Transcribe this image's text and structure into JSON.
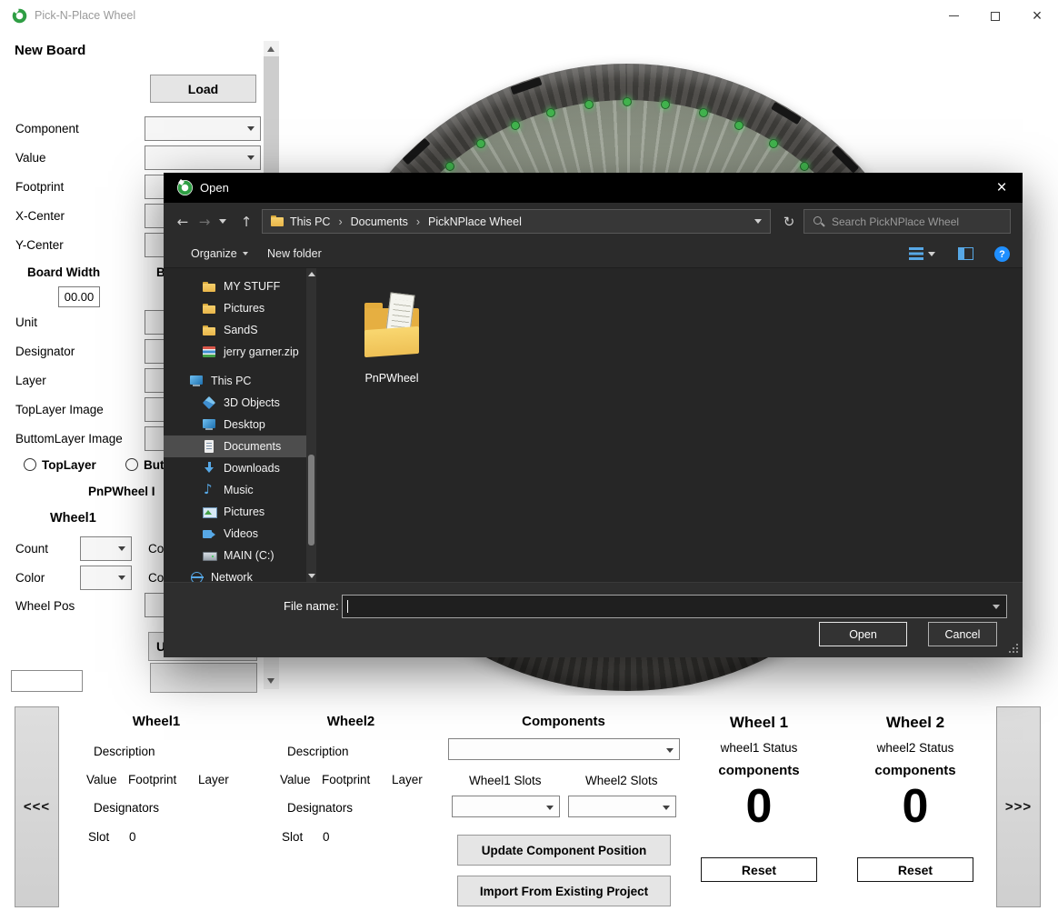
{
  "colors": {
    "accent_blue": "#1f8fff",
    "folder_yellow": "#f0c04a",
    "led_green": "#41b24d",
    "dialog_bg": "#262626",
    "selection_gray": "#4d4d4d"
  },
  "titlebar": {
    "title": "Pick-N-Place Wheel",
    "close_glyph": "×"
  },
  "left_panel": {
    "heading": "New Board",
    "load_button": "Load",
    "component_label": "Component",
    "value_label": "Value",
    "footprint_label": "Footprint",
    "x_center_label": "X-Center",
    "y_center_label": "Y-Center",
    "board_width_label": "Board Width",
    "board_height_partial": "B",
    "board_width_value": "00.00",
    "unit_label": "Unit",
    "designator_label": "Designator",
    "layer_label": "Layer",
    "toplayer_image_label": "TopLayer Image",
    "buttomlayer_image_label": "ButtomLayer Image",
    "radio_toplayer": "TopLayer",
    "radio_buttom_partial": "But",
    "pnpwheel_partial": "PnPWheel I",
    "wheel1_heading": "Wheel1",
    "count_label": "Count",
    "count2_partial": "Co",
    "color_label": "Color",
    "color2_partial": "Co",
    "wheel_pos_label": "Wheel Pos",
    "update_partial": "U"
  },
  "dialog": {
    "title": "Open",
    "close_glyph": "×",
    "nav": {
      "back": "←",
      "forward": "→",
      "up": "↑",
      "refresh": "↻"
    },
    "breadcrumb": [
      "This PC",
      "Documents",
      "PickNPlace Wheel"
    ],
    "breadcrumb_sep": "›",
    "search_placeholder": "Search PickNPlace Wheel",
    "organize_label": "Organize",
    "new_folder_label": "New folder",
    "help_glyph": "?",
    "sidebar": [
      {
        "label": "MY STUFF"
      },
      {
        "label": "Pictures"
      },
      {
        "label": "SandS"
      },
      {
        "label": "jerry garner.zip"
      },
      {
        "label": "This PC"
      },
      {
        "label": "3D Objects"
      },
      {
        "label": "Desktop"
      },
      {
        "label": "Documents"
      },
      {
        "label": "Downloads"
      },
      {
        "label": "Music"
      },
      {
        "label": "Pictures"
      },
      {
        "label": "Videos"
      },
      {
        "label": "MAIN (C:)"
      },
      {
        "label": "Network"
      }
    ],
    "files": [
      {
        "label": "PnPWheel"
      }
    ],
    "file_name_label": "File name:",
    "file_name_value": "",
    "open_button": "Open",
    "cancel_button": "Cancel"
  },
  "bottom_panel": {
    "prev_button": "<<<",
    "next_button": ">>>",
    "wheel1": {
      "heading": "Wheel1",
      "description_label": "Description",
      "columns": [
        "Value",
        "Footprint",
        "Layer"
      ],
      "designators_label": "Designators",
      "slot_label": "Slot",
      "slot_value": "0"
    },
    "wheel2": {
      "heading": "Wheel2",
      "description_label": "Description",
      "columns": [
        "Value",
        "Footprint",
        "Layer"
      ],
      "designators_label": "Designators",
      "slot_label": "Slot",
      "slot_value": "0"
    },
    "components": {
      "heading": "Components",
      "wheel1_slots_label": "Wheel1 Slots",
      "wheel2_slots_label": "Wheel2 Slots",
      "update_button": "Update Component Position",
      "import_button": "Import From Existing Project"
    },
    "status1": {
      "heading": "Wheel 1",
      "status_text": "wheel1 Status",
      "components_label": "components",
      "count": "0",
      "reset_button": "Reset"
    },
    "status2": {
      "heading": "Wheel 2",
      "status_text": "wheel2 Status",
      "components_label": "components",
      "count": "0",
      "reset_button": "Reset"
    }
  }
}
